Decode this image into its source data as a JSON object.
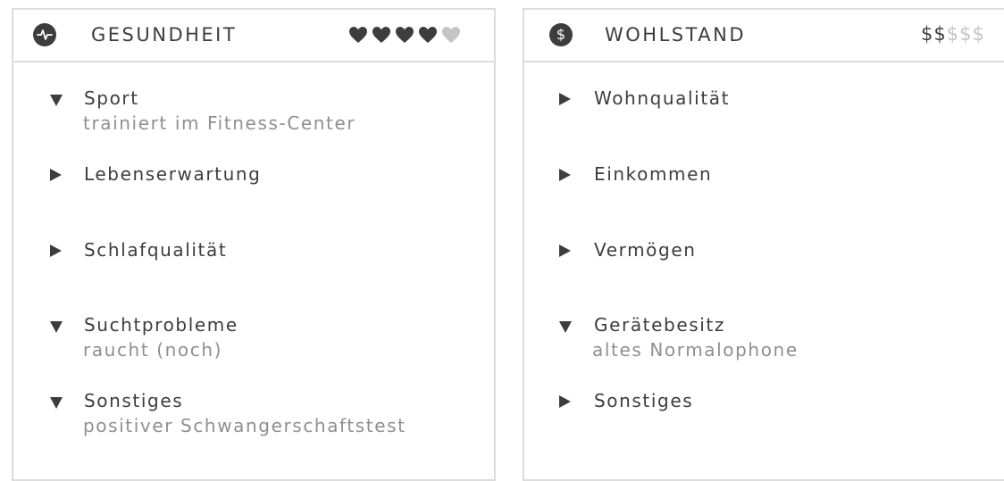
{
  "health": {
    "title": "GESUNDHEIT",
    "icon": "heartbeat-icon",
    "rating": {
      "value": 4,
      "max": 5,
      "filled_color": "#3d3d3d",
      "empty_color": "#c4c4c4"
    },
    "items": [
      {
        "label": "Sport",
        "detail": "trainiert im Fitness-Center",
        "expanded": true
      },
      {
        "label": "Lebenserwartung",
        "detail": "",
        "expanded": false
      },
      {
        "label": "Schlafqualität",
        "detail": "",
        "expanded": false
      },
      {
        "label": "Suchtprobleme",
        "detail": "raucht (noch)",
        "expanded": true
      },
      {
        "label": "Sonstiges",
        "detail": "positiver Schwangerschaftstest",
        "expanded": true
      }
    ]
  },
  "wealth": {
    "title": "WOHLSTAND",
    "icon": "dollar-icon",
    "rating": {
      "value": 2,
      "max": 5,
      "filled_color": "#3d3d3d",
      "empty_color": "#c4c4c4"
    },
    "rating_symbol": "$",
    "items": [
      {
        "label": "Wohnqualität",
        "detail": "",
        "expanded": false
      },
      {
        "label": "Einkommen",
        "detail": "",
        "expanded": false
      },
      {
        "label": "Vermögen",
        "detail": "",
        "expanded": false
      },
      {
        "label": "Gerätebesitz",
        "detail": "altes Normalophone",
        "expanded": true
      },
      {
        "label": "Sonstiges",
        "detail": "",
        "expanded": false
      }
    ]
  },
  "colors": {
    "text": "#3d3d3d",
    "detail_text": "#8f8f8f",
    "border": "#dcdcdc",
    "inactive": "#c4c4c4"
  }
}
